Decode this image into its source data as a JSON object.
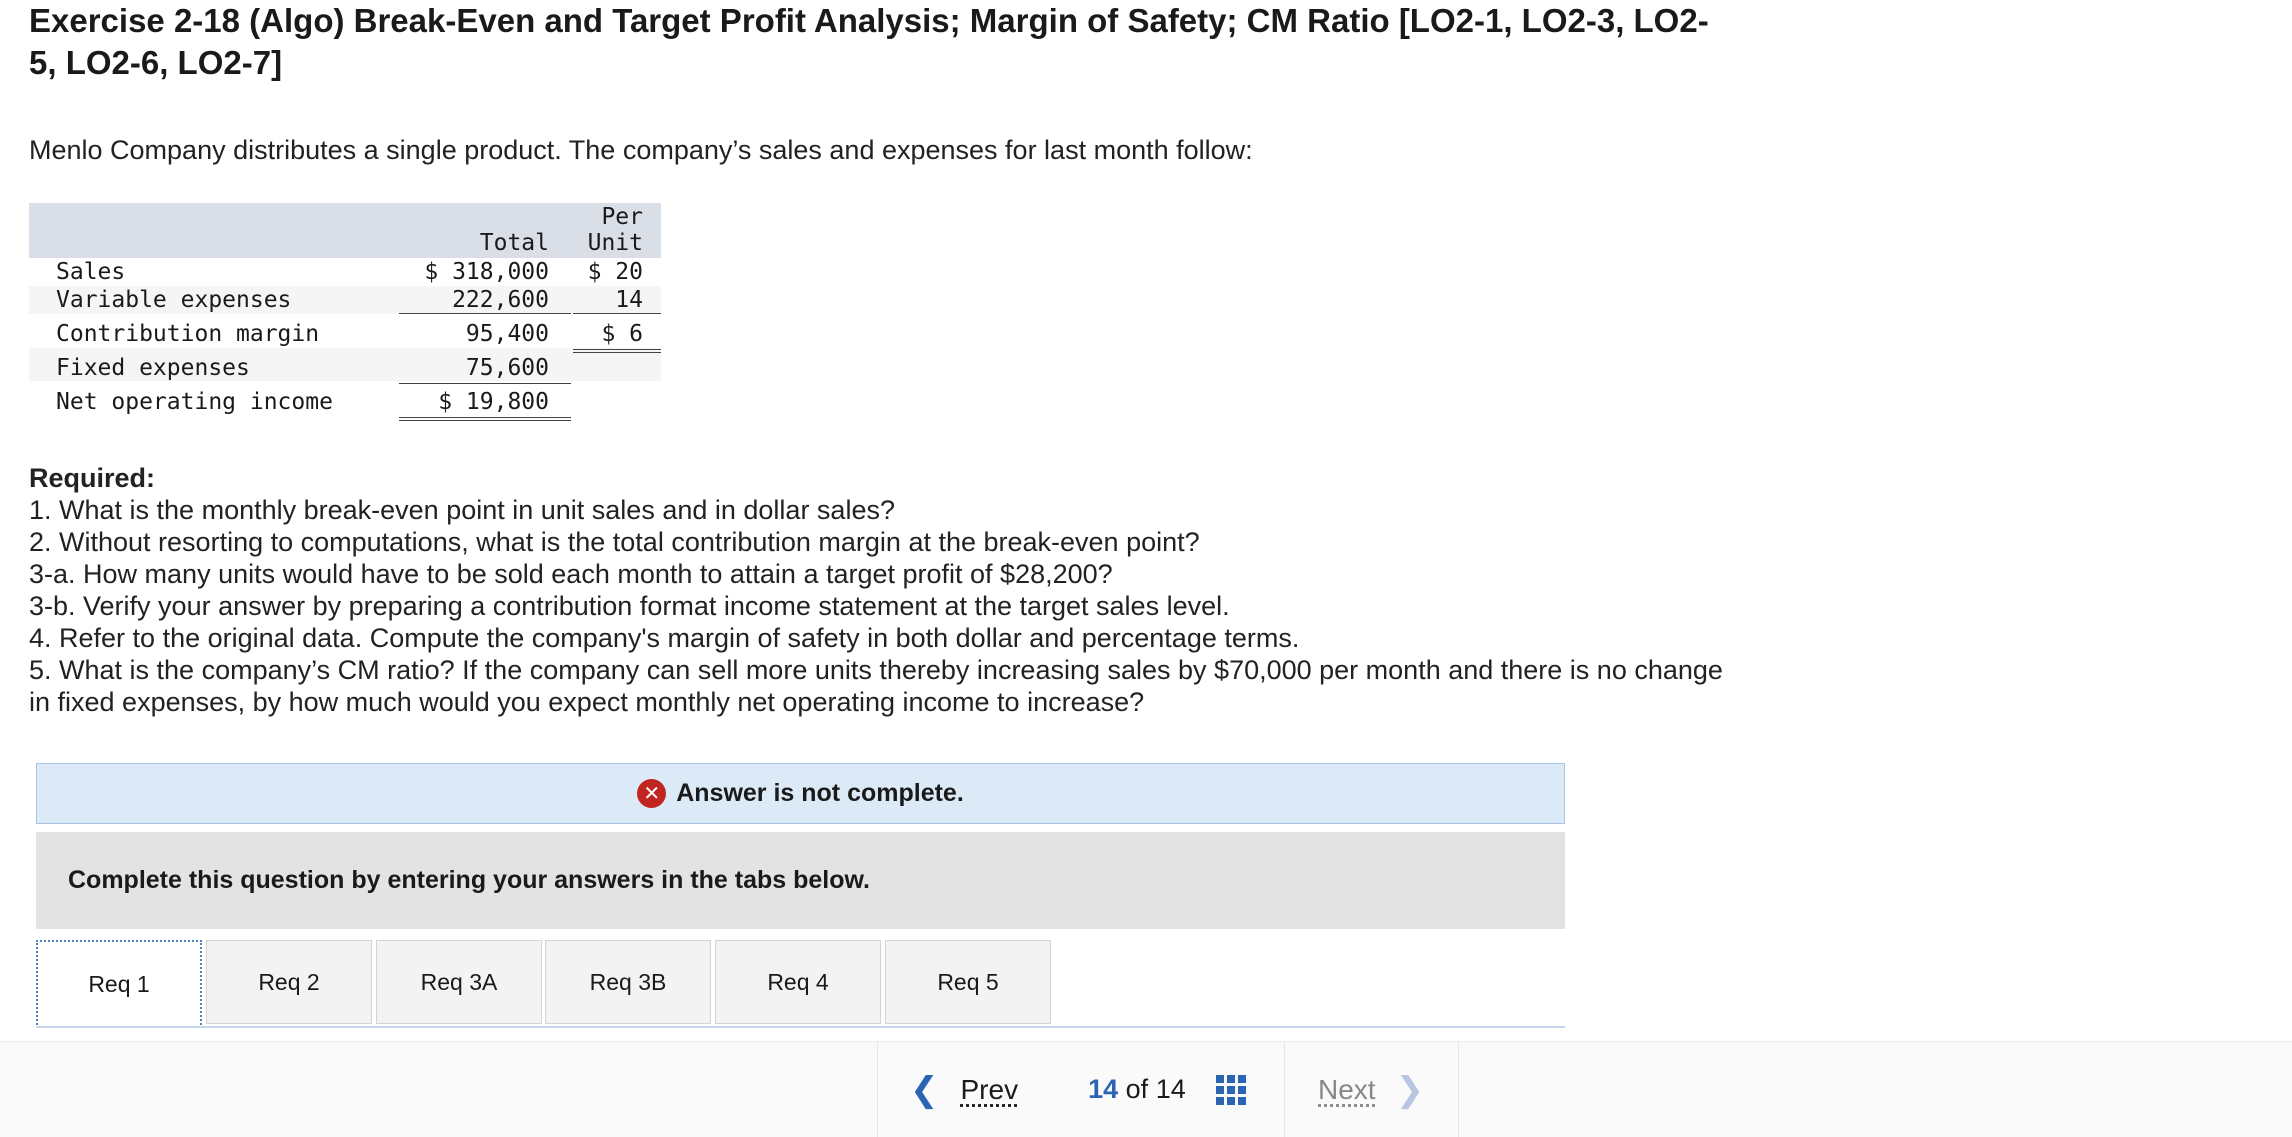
{
  "title": "Exercise 2-18 (Algo) Break-Even and Target Profit Analysis; Margin of Safety; CM Ratio [LO2-1, LO2-3, LO2-5, LO2-6, LO2-7]",
  "intro": "Menlo Company distributes a single product. The company’s sales and expenses for last month follow:",
  "table": {
    "col_total": "Total",
    "col_per_1": "Per",
    "col_per_2": "Unit",
    "rows": [
      {
        "label": "Sales",
        "total": "$ 318,000",
        "per": "$ 20"
      },
      {
        "label": "Variable expenses",
        "total": "222,600",
        "per": "14"
      },
      {
        "label": "Contribution margin",
        "total": "95,400",
        "per": "$ 6"
      },
      {
        "label": "Fixed expenses",
        "total": "75,600",
        "per": ""
      },
      {
        "label": "Net operating income",
        "total": "$ 19,800",
        "per": ""
      }
    ]
  },
  "required": {
    "heading": "Required:",
    "items": [
      "1. What is the monthly break-even point in unit sales and in dollar sales?",
      "2. Without resorting to computations, what is the total contribution margin at the break-even point?",
      "3-a. How many units would have to be sold each month to attain a target profit of $28,200?",
      "3-b. Verify your answer by preparing a contribution format income statement at the target sales level.",
      "4. Refer to the original data. Compute the company's margin of safety in both dollar and percentage terms.",
      "5. What is the company’s CM ratio? If the company can sell more units thereby increasing sales by $70,000 per month and there is no change in fixed expenses, by how much would you expect monthly net operating income to increase?"
    ]
  },
  "banner": {
    "icon": "x-circle-icon",
    "text": "Answer is not complete.",
    "color": "#c0251f"
  },
  "instruction": "Complete this question by entering your answers in the tabs below.",
  "tabs": [
    "Req 1",
    "Req 2",
    "Req 3A",
    "Req 3B",
    "Req 4",
    "Req 5"
  ],
  "active_tab": "Req 1",
  "nav": {
    "prev_label": "Prev",
    "next_label": "Next",
    "current_page": "14",
    "of_label": "of",
    "total_pages": "14"
  },
  "accent_color": "#2c64b4"
}
